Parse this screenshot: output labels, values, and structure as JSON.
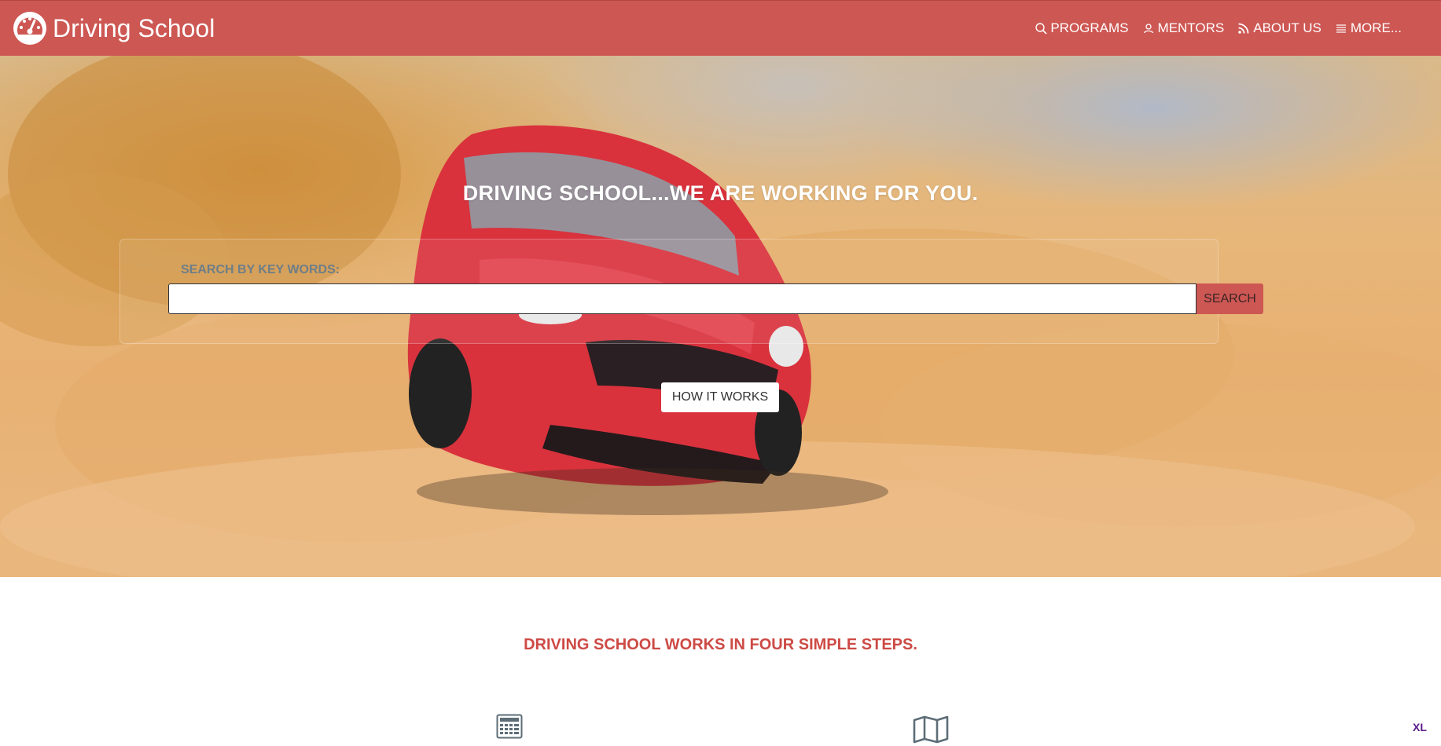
{
  "brand": {
    "name": "Driving School",
    "logo_icon": "speedometer-icon"
  },
  "nav": {
    "items": [
      {
        "label": "PROGRAMS",
        "icon": "search-icon"
      },
      {
        "label": "MENTORS",
        "icon": "user-icon"
      },
      {
        "label": "ABOUT US",
        "icon": "rss-icon"
      },
      {
        "label": "MORE...",
        "icon": "list-icon"
      }
    ]
  },
  "hero": {
    "title": "DRIVING SCHOOL...WE ARE WORKING FOR YOU.",
    "search_label": "SEARCH BY KEY WORDS:",
    "search_value": "",
    "search_button": "SEARCH",
    "how_button": "HOW IT WORKS"
  },
  "steps": {
    "title": "DRIVING SCHOOL WORKS IN FOUR SIMPLE STEPS.",
    "icons": [
      "calculator-icon",
      "map-icon"
    ]
  },
  "badge": "XL",
  "colors": {
    "accent": "#cd5753",
    "heading": "#cd4a45",
    "badge": "#5a1a8a"
  }
}
